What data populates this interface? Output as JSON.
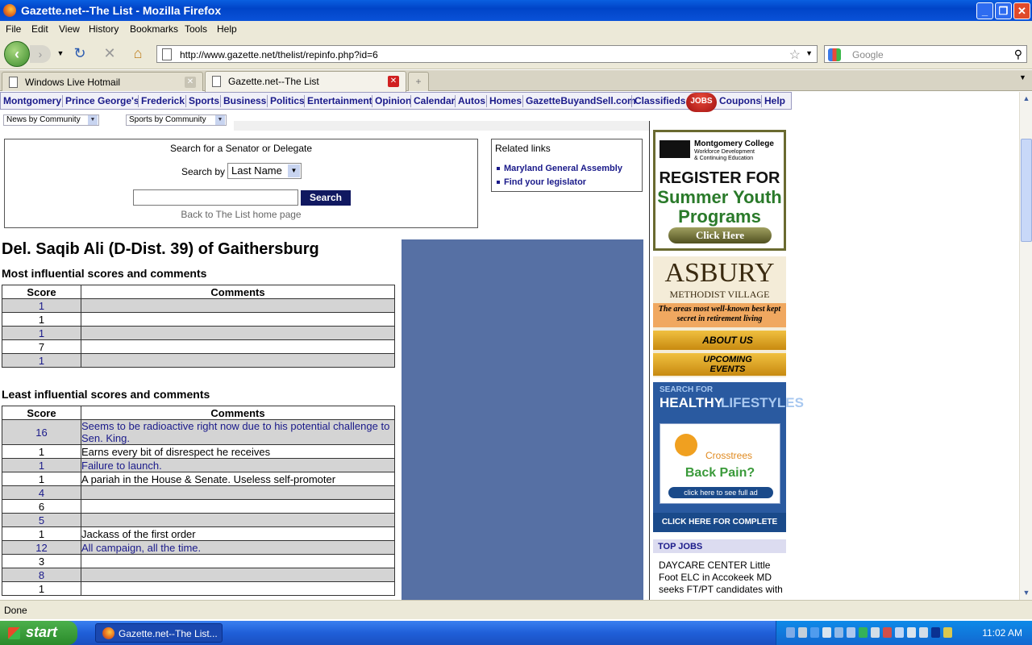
{
  "window": {
    "title": "Gazette.net--The List - Mozilla Firefox"
  },
  "menu": [
    "File",
    "Edit",
    "View",
    "History",
    "Bookmarks",
    "Tools",
    "Help"
  ],
  "url": "http://www.gazette.net/thelist/repinfo.php?id=6",
  "search_placeholder": "Google",
  "tabs": [
    {
      "label": "Windows Live Hotmail",
      "active": false
    },
    {
      "label": "Gazette.net--The List",
      "active": true
    }
  ],
  "site_nav": [
    "Montgomery",
    "Prince George's",
    "Frederick",
    "Sports",
    "Business",
    "Politics",
    "Entertainment",
    "Opinion",
    "Calendar",
    "Autos",
    "Homes",
    "GazetteBuyandSell.com",
    "Classifieds",
    "JOBS",
    "Coupons",
    "Help"
  ],
  "dropdowns": {
    "news": "News by Community",
    "sports": "Sports by Community"
  },
  "search_panel": {
    "heading": "Search for a Senator or Delegate",
    "search_by_label": "Search by",
    "search_by_value": "Last Name",
    "button": "Search",
    "back_link": "Back to The List home page"
  },
  "related": {
    "heading": "Related links",
    "links": [
      "Maryland General Assembly",
      "Find your legislator"
    ]
  },
  "page_title": "Del. Saqib Ali (D-Dist. 39) of Gaithersburg",
  "most": {
    "heading": "Most influential scores and comments",
    "headers": [
      "Score",
      "Comments"
    ],
    "rows": [
      {
        "score": "1",
        "comment": ""
      },
      {
        "score": "1",
        "comment": ""
      },
      {
        "score": "1",
        "comment": ""
      },
      {
        "score": "7",
        "comment": ""
      },
      {
        "score": "1",
        "comment": ""
      }
    ]
  },
  "least": {
    "heading": "Least influential scores and comments",
    "headers": [
      "Score",
      "Comments"
    ],
    "rows": [
      {
        "score": "16",
        "comment": "Seems to be radioactive right now due to his potential challenge to Sen. King."
      },
      {
        "score": "1",
        "comment": "Earns every bit of disrespect he receives"
      },
      {
        "score": "1",
        "comment": "Failure to launch."
      },
      {
        "score": "1",
        "comment": "A pariah in the House & Senate. Useless self-promoter"
      },
      {
        "score": "4",
        "comment": ""
      },
      {
        "score": "6",
        "comment": ""
      },
      {
        "score": "5",
        "comment": ""
      },
      {
        "score": "1",
        "comment": "Jackass of the first order"
      },
      {
        "score": "12",
        "comment": "All campaign, all the time."
      },
      {
        "score": "3",
        "comment": ""
      },
      {
        "score": "8",
        "comment": ""
      },
      {
        "score": "1",
        "comment": ""
      }
    ]
  },
  "ads": {
    "mc": {
      "brand": "Montgomery College",
      "sub1": "Workforce Development",
      "sub2": "& Continuing Education",
      "l1": "REGISTER FOR",
      "l2": "Summer Youth",
      "l3": "Programs",
      "btn": "Click Here"
    },
    "asbury": {
      "l1": "ASBURY",
      "l2": "METHODIST VILLAGE",
      "tag": "The areas most well-known best kept secret in  retirement living",
      "b1": "ABOUT US",
      "b2": "UPCOMING EVENTS"
    },
    "health": {
      "l1": "SEARCH FOR",
      "l2a": "HEALTHY",
      "l2b": "LIFESTYLES",
      "brand": "Crosstrees",
      "q": "Back Pain?",
      "btn": "click here to see full ad",
      "foot": "CLICK HERE FOR COMPLETE LIST"
    }
  },
  "top_jobs": {
    "heading": "TOP JOBS",
    "text": "DAYCARE CENTER Little Foot ELC in Accokeek MD seeks FT/PT candidates with"
  },
  "status": "Done",
  "taskbar": {
    "start": "start",
    "item": "Gazette.net--The List...",
    "clock": "11:02 AM"
  }
}
